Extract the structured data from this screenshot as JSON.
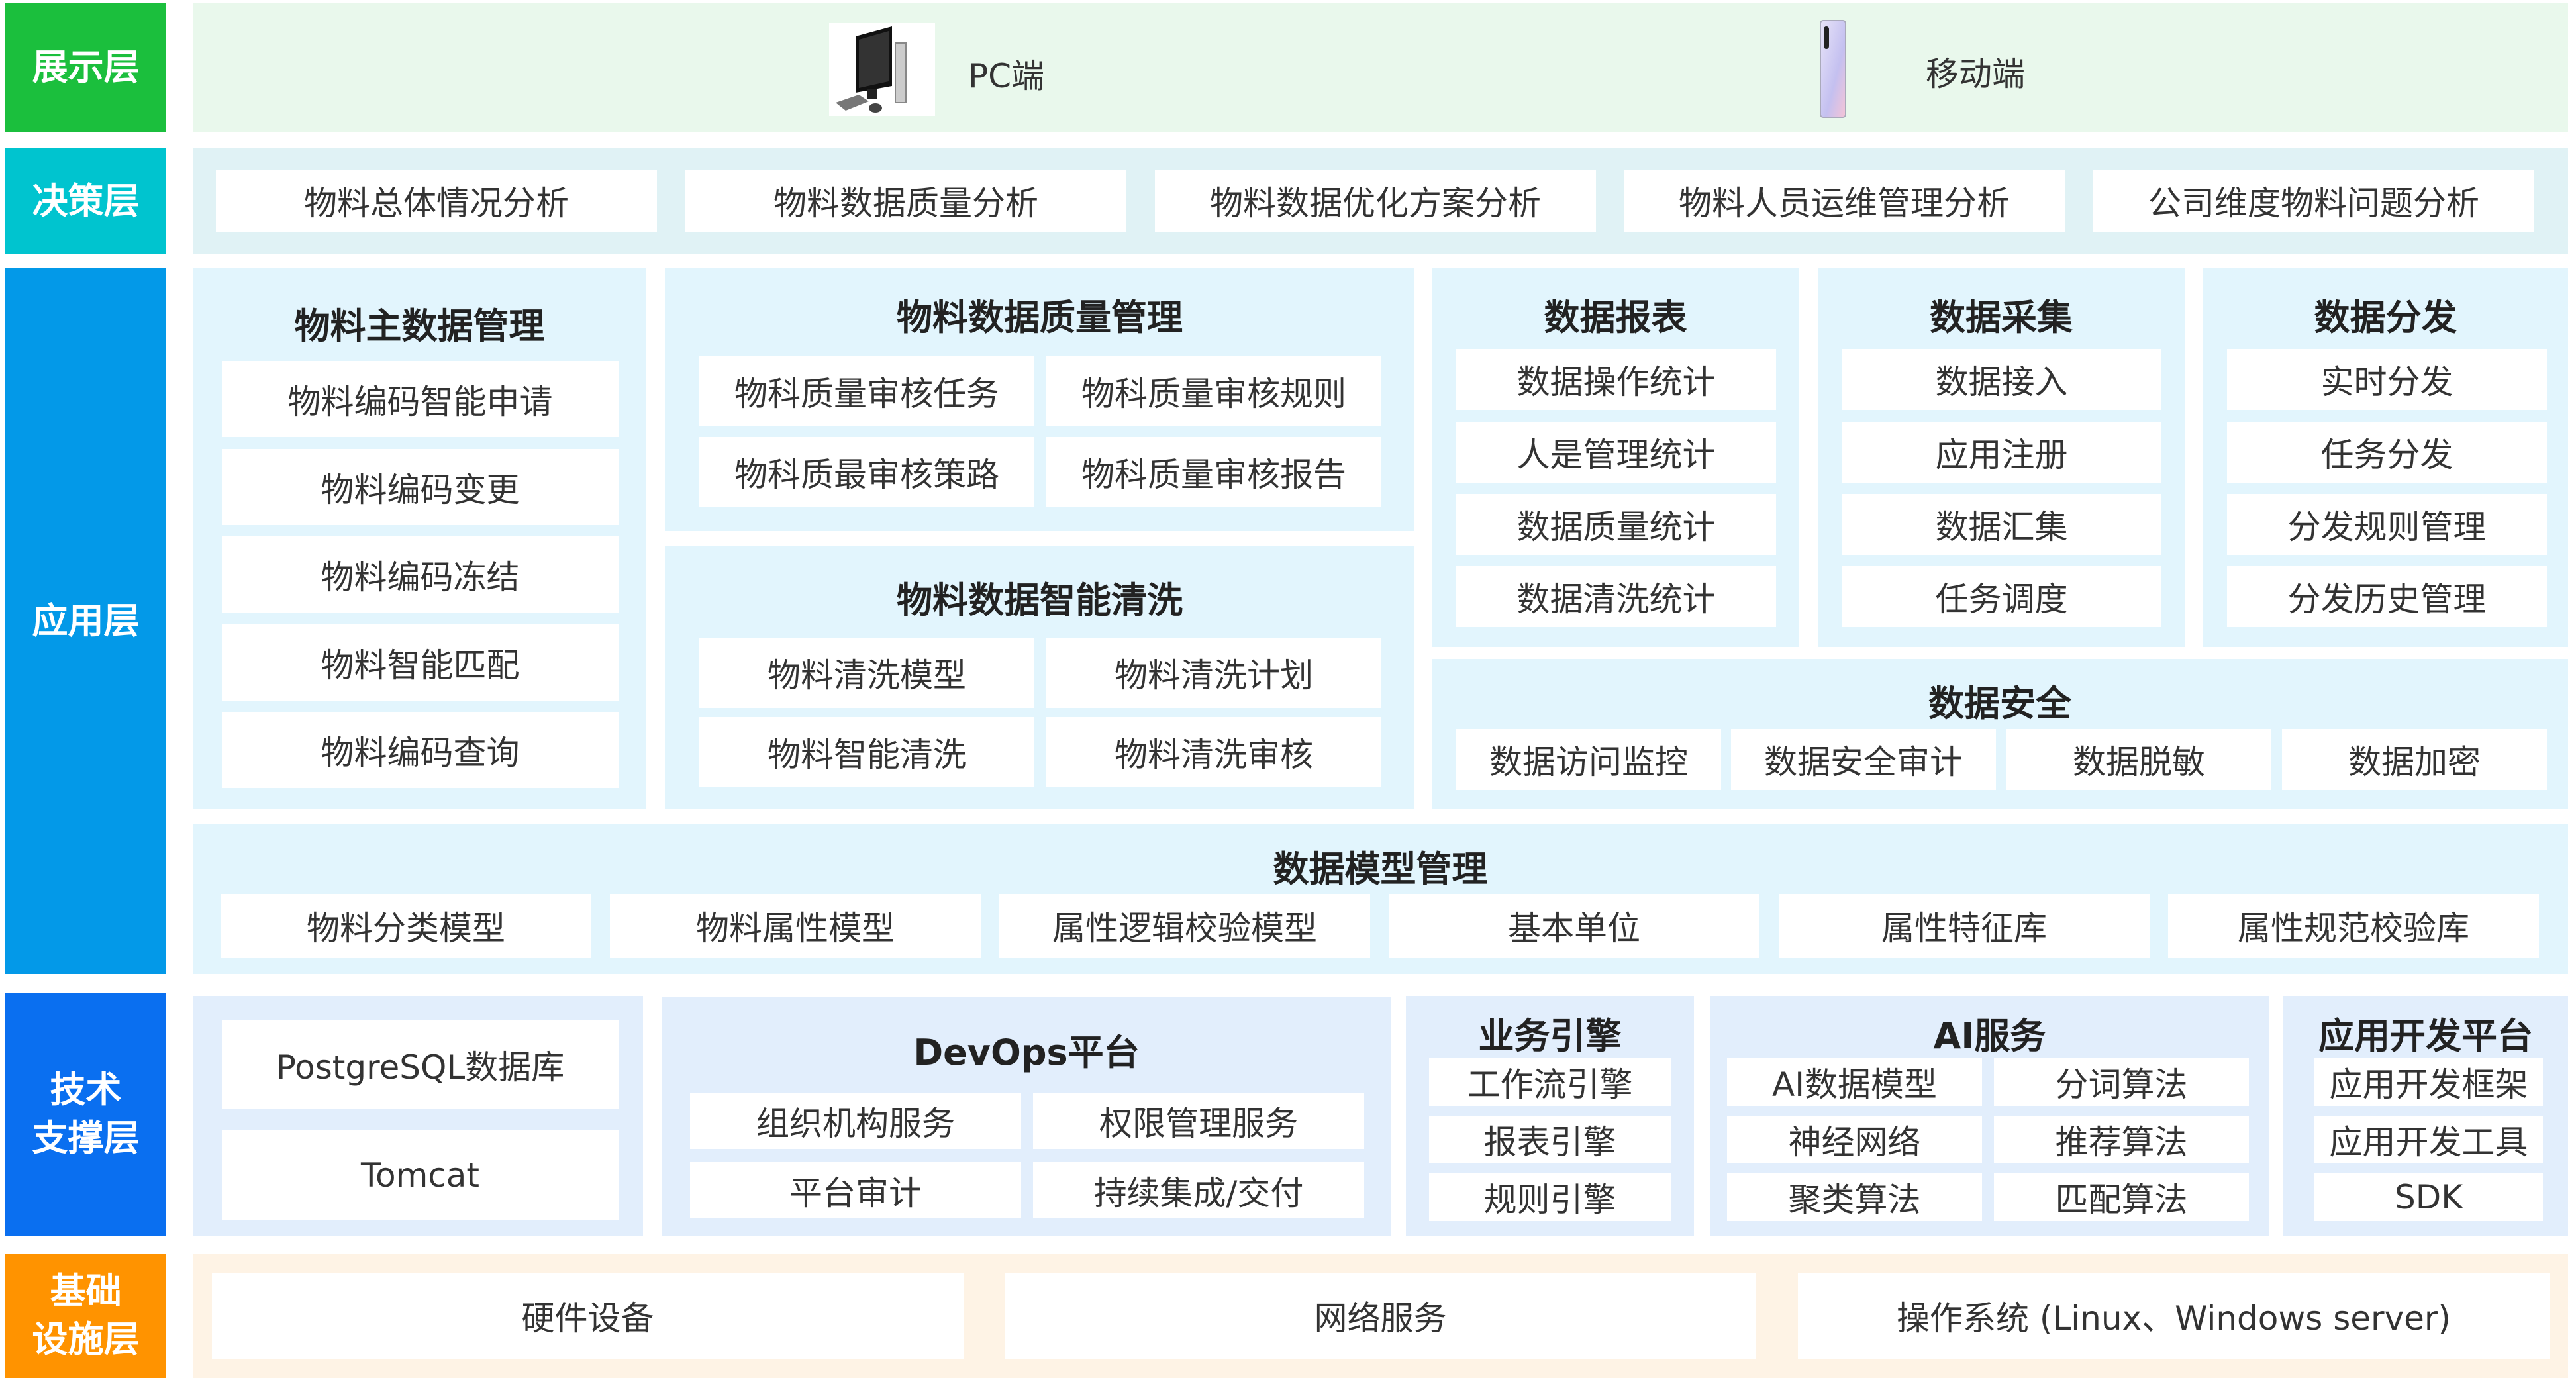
{
  "layers": {
    "presentation": "展示层",
    "decision": "决策层",
    "application": "应用层",
    "tech": "技术\n支撑层",
    "infra": "基础\n设施层"
  },
  "colors": {
    "presentation": "#1bbf3d",
    "decision": "#00c4cf",
    "application": "#0399e8",
    "tech": "#0a6ff0",
    "infra": "#ff9300"
  },
  "presentation": {
    "pc": {
      "label": "PC端",
      "icon": "desktop-computer-icon"
    },
    "mobile": {
      "label": "移动端",
      "icon": "smartphone-icon"
    }
  },
  "decision": [
    "物料总体情况分析",
    "物料数据质量分析",
    "物料数据优化方案分析",
    "物料人员运维管理分析",
    "公司维度物料问题分析"
  ],
  "application": {
    "master": {
      "title": "物料主数据管理",
      "items": [
        "物料编码智能申请",
        "物料编码变更",
        "物料编码冻结",
        "物料智能匹配",
        "物料编码查询"
      ]
    },
    "quality": {
      "title": "物料数据质量管理",
      "items": [
        "物科质量审核任务",
        "物科质量审核规则",
        "物科质最审核策路",
        "物科质量审核报告"
      ]
    },
    "cleaning": {
      "title": "物料数据智能清洗",
      "items": [
        "物料清洗模型",
        "物料清洗计划",
        "物料智能清洗",
        "物料清洗审核"
      ]
    },
    "report": {
      "title": "数据报表",
      "items": [
        "数据操作统计",
        "人是管理统计",
        "数据质量统计",
        "数据清洗统计"
      ]
    },
    "collect": {
      "title": "数据采集",
      "items": [
        "数据接入",
        "应用注册",
        "数据汇集",
        "任务调度"
      ]
    },
    "distribute": {
      "title": "数据分发",
      "items": [
        "实时分发",
        "任务分发",
        "分发规则管理",
        "分发历史管理"
      ]
    },
    "security": {
      "title": "数据安全",
      "items": [
        "数据访问监控",
        "数据安全审计",
        "数据脱敏",
        "数据加密"
      ]
    },
    "model": {
      "title": "数据模型管理",
      "items": [
        "物料分类模型",
        "物料属性模型",
        "属性逻辑校验模型",
        "基本单位",
        "属性特征库",
        "属性规范校验库"
      ]
    }
  },
  "tech": {
    "db": {
      "items": [
        "PostgreSQL数据库",
        "Tomcat"
      ]
    },
    "devops": {
      "title": "DevOps平台",
      "items": [
        "组织机构服务",
        "权限管理服务",
        "平台审计",
        "持续集成/交付"
      ]
    },
    "engine": {
      "title": "业务引擎",
      "items": [
        "工作流引擎",
        "报表引擎",
        "规则引擎"
      ]
    },
    "ai": {
      "title": "AI服务",
      "items": [
        "AI数据模型",
        "分词算法",
        "神经网络",
        "推荐算法",
        "聚类算法",
        "匹配算法"
      ]
    },
    "devplatform": {
      "title": "应用开发平台",
      "items": [
        "应用开发框架",
        "应用开发工具",
        "SDK"
      ]
    }
  },
  "infra": [
    "硬件设备",
    "网络服务",
    "操作系统 (Linux、Windows server)"
  ]
}
